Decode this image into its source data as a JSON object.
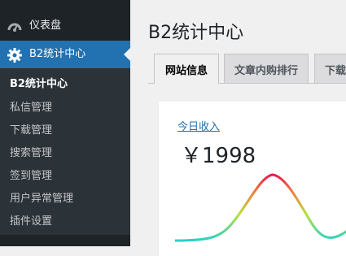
{
  "sidebar": {
    "dashboard_label": "仪表盘",
    "b2_label": "B2统计中心",
    "submenu": [
      "B2统计中心",
      "私信管理",
      "下载管理",
      "搜索管理",
      "签到管理",
      "用户异常管理",
      "插件设置"
    ]
  },
  "main": {
    "title": "B2统计中心",
    "tabs": [
      "网站信息",
      "文章内购排行",
      "下载"
    ],
    "active_tab": "网站信息",
    "income_link": "今日收入",
    "income_value": "￥1998"
  },
  "colors": {
    "sidebar_bg": "#1d2327",
    "accent": "#2271b1",
    "chart_gradient": [
      "#25d1c9",
      "#b9e03a",
      "#f05a3a",
      "#e8194f"
    ]
  }
}
